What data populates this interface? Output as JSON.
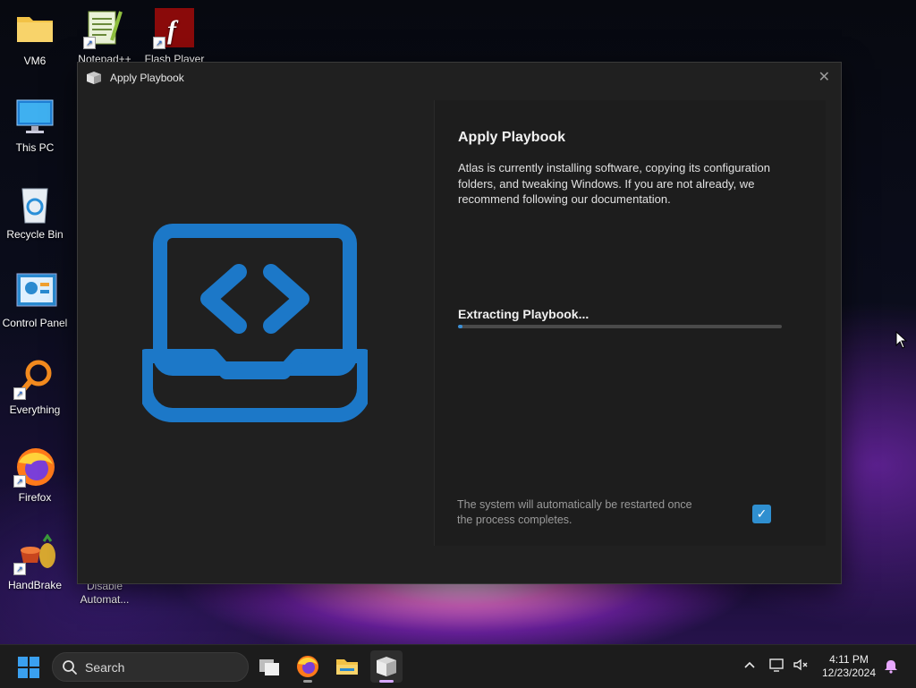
{
  "desktop": {
    "icons": [
      {
        "label": "VM6"
      },
      {
        "label": "Notepad++"
      },
      {
        "label": "Flash Player"
      },
      {
        "label": "This PC"
      },
      {
        "label": "Recycle Bin"
      },
      {
        "label": "Control Panel"
      },
      {
        "label": "Everything"
      },
      {
        "label": "Firefox"
      },
      {
        "label": "HandBrake"
      },
      {
        "label": "Disable Automat..."
      }
    ]
  },
  "dialog": {
    "window_title": "Apply Playbook",
    "close_glyph": "✕",
    "heading": "Apply Playbook",
    "description": "Atlas is currently installing software, copying its configuration folders, and tweaking Windows. If you are not already, we recommend following our documentation.",
    "status": "Extracting Playbook...",
    "progress_fraction": 0.015,
    "restart_note": "The system will automatically be restarted once the process completes.",
    "restart_checked": true,
    "check_glyph": "✓",
    "accent_color": "#2f8fd0"
  },
  "taskbar": {
    "search_placeholder": "Search",
    "apps": [
      "task-view-icon",
      "firefox-icon",
      "file-explorer-icon",
      "atlas-playbook-icon"
    ],
    "time": "4:11 PM",
    "date": "12/23/2024"
  }
}
